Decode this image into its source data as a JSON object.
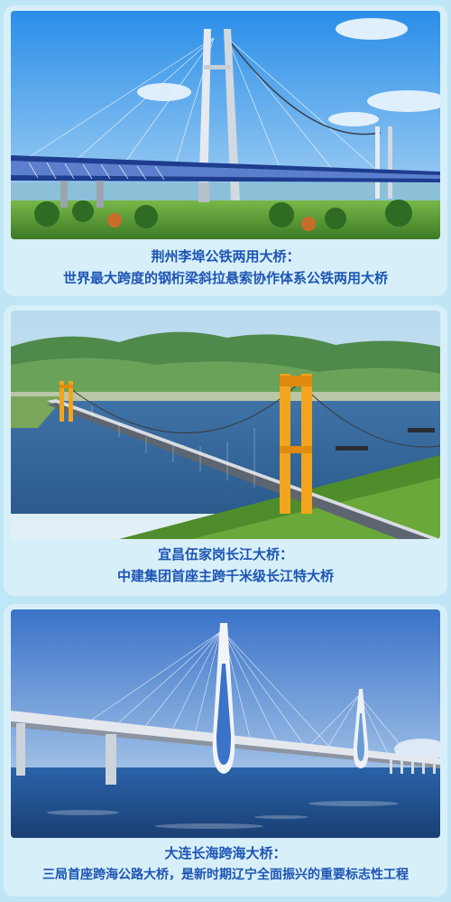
{
  "bridges": [
    {
      "title": "荆州李埠公铁两用大桥：",
      "subtitle": "世界最大跨度的钢桁梁斜拉悬索协作体系公铁两用大桥",
      "image": "bridge-photo-jingzhou"
    },
    {
      "title": "宜昌伍家岗长江大桥：",
      "subtitle": "中建集团首座主跨千米级长江特大桥",
      "image": "bridge-photo-yichang"
    },
    {
      "title": "大连长海跨海大桥：",
      "subtitle": "三局首座跨海公路大桥，是新时期辽宁全面振兴的重要标志性工程",
      "image": "bridge-photo-dalian"
    }
  ],
  "colors": {
    "page_background": "#bfe6f5",
    "card_background": "#d7eff8",
    "caption_text": "#1e55b4",
    "tower_orange": "#f2a51c"
  }
}
